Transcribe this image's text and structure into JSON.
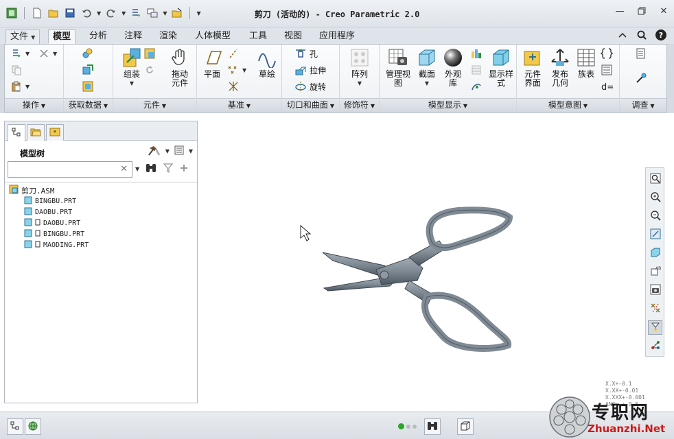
{
  "window": {
    "title": "剪刀 (活动的) - Creo Parametric 2.0",
    "controls": [
      "minimize-icon",
      "restore-icon",
      "close-icon"
    ]
  },
  "quick_access": [
    "app-icon",
    "new-icon",
    "open-icon",
    "save-icon",
    "undo-icon",
    "redo-icon",
    "regenerate-icon",
    "windows-icon",
    "close-window-icon",
    "customize-icon"
  ],
  "tabs": [
    {
      "label": "文件"
    },
    {
      "label": "模型"
    },
    {
      "label": "分析"
    },
    {
      "label": "注释"
    },
    {
      "label": "渲染"
    },
    {
      "label": "人体模型"
    },
    {
      "label": "工具"
    },
    {
      "label": "视图"
    },
    {
      "label": "应用程序"
    }
  ],
  "ribbon": {
    "groups": [
      {
        "label": "操作"
      },
      {
        "label": "获取数据"
      },
      {
        "label": "元件"
      },
      {
        "label": "基准"
      },
      {
        "label": "切口和曲面"
      },
      {
        "label": "修饰符"
      },
      {
        "label": "模型显示"
      },
      {
        "label": "模型意图"
      },
      {
        "label": "调查"
      }
    ],
    "buttons": {
      "assemble": "组装",
      "drag": "拖动\n元件",
      "plane": "平面",
      "sketch": "草绘",
      "hole": "孔",
      "extrude": "拉伸",
      "revolve": "旋转",
      "pattern": "阵列",
      "manage_views": "管理视\n图",
      "section": "截面",
      "appearance": "外观\n库",
      "display_style": "显示样\n式",
      "component_interface": "元件\n界面",
      "publish_geometry": "发布\n几何",
      "family_table": "族表"
    }
  },
  "model_tree": {
    "title": "模型树",
    "search_value": "",
    "nodes": [
      {
        "label": "剪刀.ASM"
      },
      {
        "label": "BINGBU.PRT"
      },
      {
        "label": "DAOBU.PRT"
      },
      {
        "label": "DAOBU.PRT"
      },
      {
        "label": "BINGBU.PRT"
      },
      {
        "label": "MAODING.PRT"
      }
    ]
  },
  "tolerance": [
    "X.X+-0.1",
    "X.XX+-0.01",
    "X.XXX+-0.001",
    "ANG. +-0.5"
  ],
  "watermark": {
    "cn": "专职网",
    "en": "Zhuanzhi.Net"
  },
  "colors": {
    "model": "#7f8a94",
    "ribbon_bg": "#f4f6f8",
    "status_green": "#2aa52a"
  }
}
